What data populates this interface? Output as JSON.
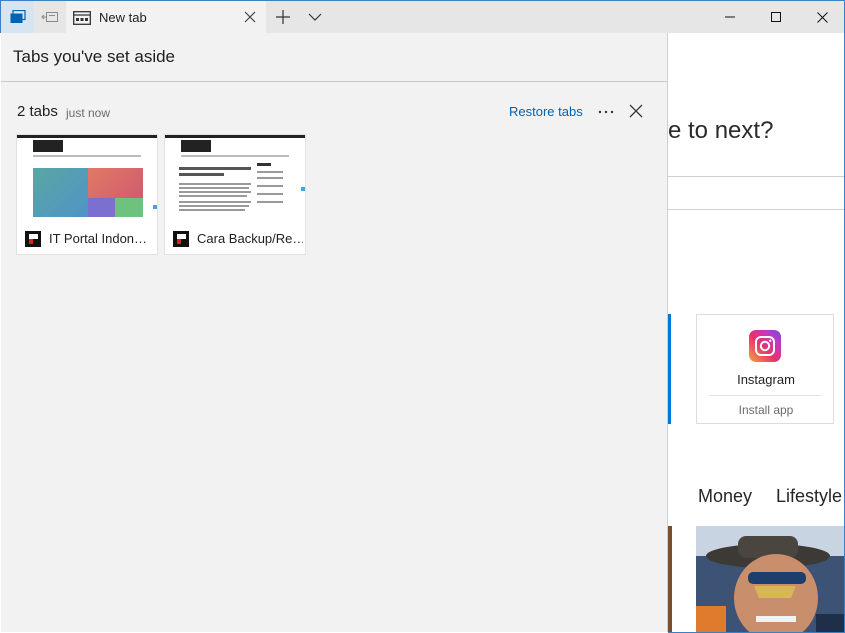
{
  "browser": {
    "active_tab": {
      "title": "New tab"
    }
  },
  "panel": {
    "title": "Tabs you've set aside",
    "group": {
      "count_label": "2 tabs",
      "time_label": "just now",
      "restore_label": "Restore tabs",
      "more_label": "···",
      "tabs": [
        {
          "title": "IT Portal Indon…"
        },
        {
          "title": "Cara Backup/Re…"
        }
      ]
    }
  },
  "new_tab_page": {
    "question_fragment": "e to next?",
    "app_tile": {
      "name": "Instagram",
      "action": "Install app"
    },
    "nav": [
      "Money",
      "Lifestyle"
    ]
  },
  "colors": {
    "accent": "#0078d7",
    "link": "#0063b1",
    "panel_bg": "#f2f2f2",
    "titlebar_bg": "#e6e6e6"
  },
  "icons": {
    "tabs_aside": "tabs-aside-icon",
    "set_aside": "set-aside-tabs-icon",
    "new_tab_page": "new-tab-page-icon",
    "close": "close-icon",
    "new_tab": "plus-icon",
    "tab_menu": "chevron-down-icon",
    "minimize": "minimize-icon",
    "maximize": "maximize-icon",
    "window_close": "window-close-icon",
    "more": "more-icon",
    "site": "site-favicon-icon"
  }
}
